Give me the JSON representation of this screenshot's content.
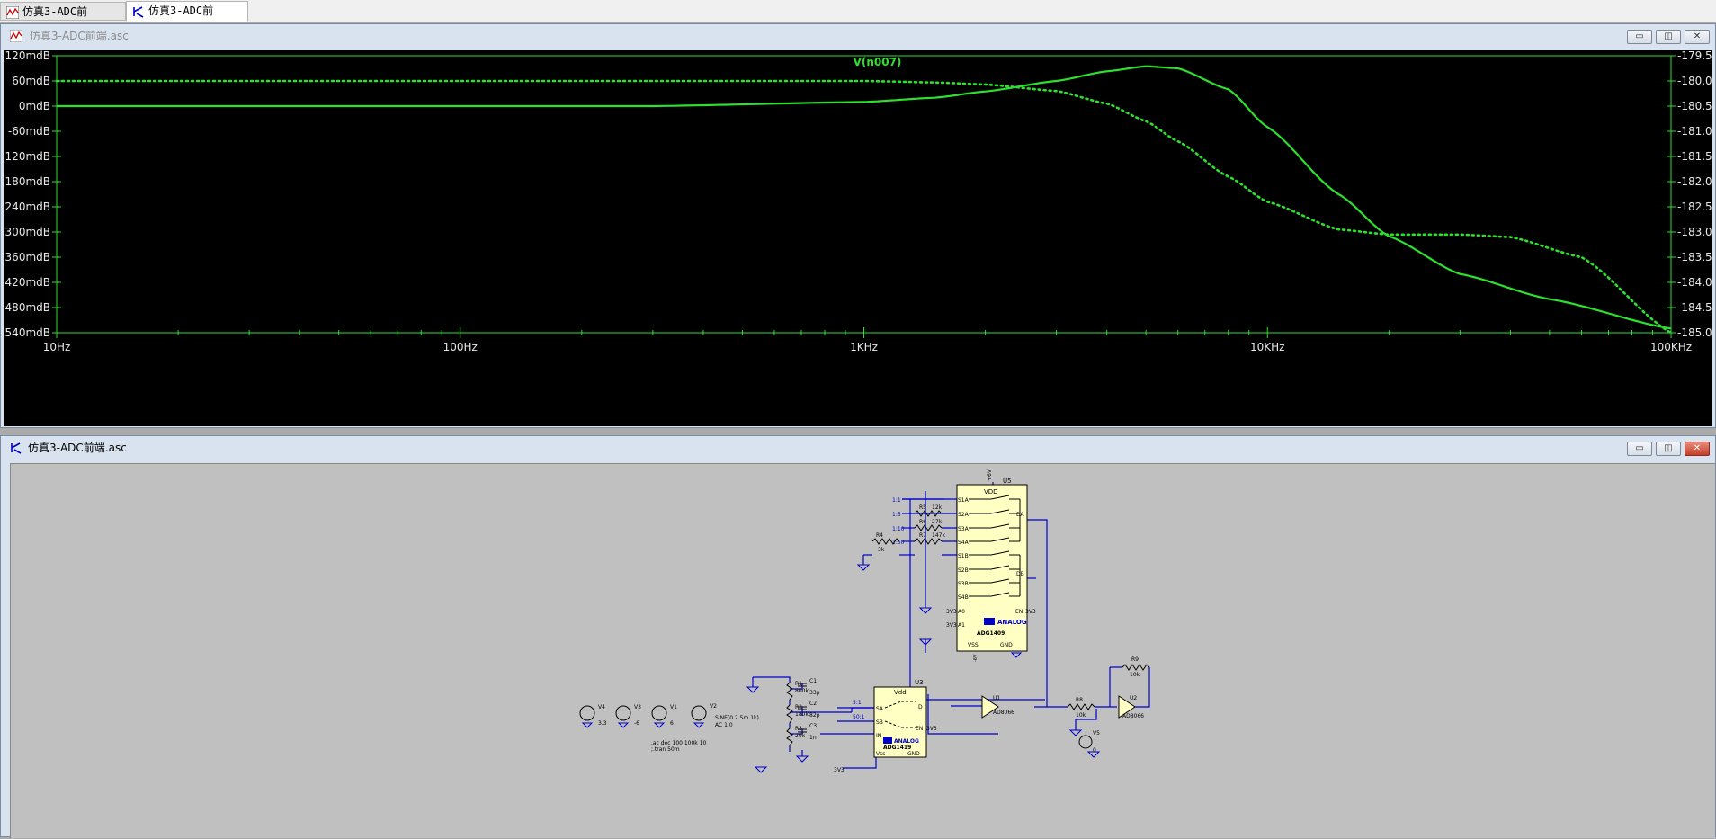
{
  "tabs": [
    {
      "label": "仿真3-ADC前端.asc",
      "icon": "waveform-icon",
      "active": false
    },
    {
      "label": "仿真3-ADC前端.asc",
      "icon": "schematic-icon",
      "active": true
    }
  ],
  "plot_window": {
    "title": "仿真3-ADC前端.asc",
    "buttons": {
      "minimize": "▭",
      "restore": "◫",
      "close": "✕"
    }
  },
  "schematic_window": {
    "title": "仿真3-ADC前端.asc",
    "buttons": {
      "minimize": "▭",
      "restore": "◫",
      "close": "✕"
    }
  },
  "colors": {
    "trace": "#2ee02e",
    "axis": "#2ee02e",
    "label": "#e8e8e8",
    "wire": "#0000c8",
    "part_fill": "#ffffc4"
  },
  "chart_data": {
    "type": "line",
    "title": "V(n007)",
    "x_scale": "log",
    "xlim": [
      10,
      100000
    ],
    "x_ticks": [
      "10Hz",
      "100Hz",
      "1KHz",
      "10KHz",
      "100KHz"
    ],
    "x_tick_values": [
      10,
      100,
      1000,
      10000,
      100000
    ],
    "y_left_ticks": [
      "120mdB",
      "60mdB",
      "0mdB",
      "-60mdB",
      "-120mdB",
      "-180mdB",
      "-240mdB",
      "-300mdB",
      "-360mdB",
      "-420mdB",
      "-480mdB",
      "-540mdB"
    ],
    "ylim_left": [
      -540,
      120
    ],
    "y_right_ticks": [
      "-179.5°",
      "-180.0°",
      "-180.5°",
      "-181.0°",
      "-181.5°",
      "-182.0°",
      "-182.5°",
      "-183.0°",
      "-183.5°",
      "-184.0°",
      "-184.5°",
      "-185.0°"
    ],
    "ylim_right": [
      -185,
      -179.5
    ],
    "series": [
      {
        "style": "solid",
        "axis": "left",
        "x": [
          10,
          30,
          100,
          300,
          1000,
          1500,
          2000,
          3000,
          4000,
          5000,
          6000,
          8000,
          10000,
          15000,
          20000,
          30000,
          50000,
          100000
        ],
        "y": [
          0,
          0,
          0,
          0,
          10,
          20,
          35,
          60,
          83,
          95,
          90,
          40,
          -50,
          -210,
          -310,
          -400,
          -460,
          -530
        ]
      },
      {
        "style": "dotted",
        "axis": "right",
        "x": [
          10,
          100,
          300,
          1000,
          1500,
          2000,
          3000,
          4000,
          5000,
          6000,
          8000,
          10000,
          15000,
          20000,
          30000,
          40000,
          60000,
          100000
        ],
        "y": [
          -180.0,
          -180.0,
          -180.0,
          -180.0,
          -180.03,
          -180.07,
          -180.2,
          -180.45,
          -180.8,
          -181.2,
          -181.9,
          -182.4,
          -182.95,
          -183.05,
          -183.05,
          -183.1,
          -183.5,
          -185.0
        ]
      }
    ]
  },
  "schematic": {
    "labels": {
      "u5_name": "U5",
      "u5_part": "ADG1409",
      "u5_vdd": "VDD",
      "u5_vss": "VSS",
      "u5_gnd": "GND",
      "u5_en": "EN",
      "u5_da": "DA",
      "u5_db": "DB",
      "u5_a0": "A0",
      "u5_a1": "A1",
      "u5_pins": [
        "S1A",
        "S2A",
        "S3A",
        "S4A",
        "S1B",
        "S2B",
        "S3B",
        "S4B"
      ],
      "ratio_labels": [
        "1:1",
        "1:5",
        "1:10",
        "1:50"
      ],
      "r5": "R5",
      "r5v": "12k",
      "r6": "R6",
      "r6v": "27k",
      "r7": "R7",
      "r7v": "147k",
      "r4": "R4",
      "r4v": "3k",
      "v3v3": "3V3",
      "v3v3b": "3V3",
      "v3v3c": "3V3",
      "v3v3d": "3V3",
      "v3v3e": "3V3",
      "vp6": "+6V",
      "vn6": "-6V",
      "u3_name": "U3",
      "u3_part": "ADG1419",
      "u3_vdd": "Vdd",
      "u3_vss": "Vss",
      "u3_gnd": "GND",
      "u3_en": "EN",
      "u3_sa": "SA",
      "u3_sb": "SB",
      "u3_in": "IN",
      "u3_d": "D",
      "ratio_5": "5:1",
      "ratio_50": "50:1",
      "u1_name": "U1",
      "u1_part": "AD8066",
      "u2_name": "U2",
      "u2_part": "AD8066",
      "r8": "R8",
      "r8v": "10k",
      "r9": "R9",
      "r9v": "10k",
      "v5": "V5",
      "v5v": "0",
      "v4": "V4",
      "v4v": "3.3",
      "v3": "V3",
      "v3v": "-6",
      "v1": "V1",
      "v1v": "6",
      "v2": "V2",
      "v2v": "SINE(0 2.5m 1k)",
      "v2ac": "AC 1 0",
      "r1": "R1",
      "r1v": "800k",
      "r2": "R2",
      "r2v": "180k",
      "r3": "R3",
      "r3v": "20k",
      "c1": "C1",
      "c1v": "33p",
      "c2": "C2",
      "c2v": "82p",
      "c3": "C3",
      "c3v": "1n",
      "directive1": ".ac dec 100 100k 10",
      "directive2": ";.tran 50m"
    }
  }
}
